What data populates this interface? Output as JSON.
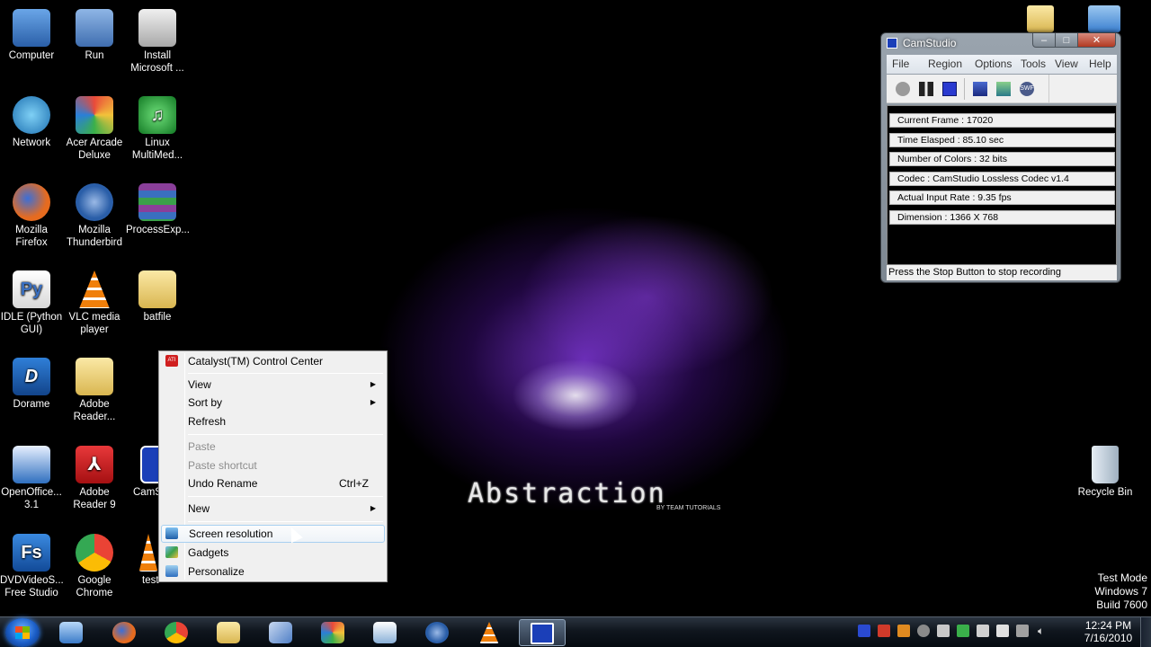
{
  "desktop": {
    "icons": [
      {
        "label": "Computer",
        "icon": "computer-icon",
        "color": "#3d7fcf"
      },
      {
        "label": "Run",
        "icon": "run-icon",
        "color": "#5e8fc9"
      },
      {
        "label": "Install Microsoft ...",
        "icon": "installer-icon",
        "color": "#c9c9c9"
      },
      {
        "label": "Network",
        "icon": "network-icon",
        "color": "#3aa0d8"
      },
      {
        "label": "Acer Arcade Deluxe",
        "icon": "acer-arcade-icon",
        "color": "#e9b84a"
      },
      {
        "label": "Linux MultiMed...",
        "icon": "music-note-icon",
        "color": "#22a33c"
      },
      {
        "label": "Mozilla Firefox",
        "icon": "firefox-icon",
        "color": "#e66b1f"
      },
      {
        "label": "Mozilla Thunderbird",
        "icon": "thunderbird-icon",
        "color": "#2a5ea8"
      },
      {
        "label": "ProcessExp...",
        "icon": "archive-icon",
        "color": "#8a3f9a"
      },
      {
        "label": "IDLE (Python GUI)",
        "icon": "python-file-icon",
        "color": "#e0d98a"
      },
      {
        "label": "VLC media player",
        "icon": "vlc-cone-icon",
        "color": "#f07f0a"
      },
      {
        "label": "batfile",
        "icon": "folder-icon",
        "color": "#e9d27a"
      },
      {
        "label": "Dorame",
        "icon": "dorame-icon",
        "color": "#1f5fa8"
      },
      {
        "label": "Adobe Reader...",
        "icon": "folder-icon",
        "color": "#e9d27a"
      },
      {
        "label": "OpenOffice... 3.1",
        "icon": "openoffice-icon",
        "color": "#2f6fbf"
      },
      {
        "label": "Adobe Reader 9",
        "icon": "adobe-reader-icon",
        "color": "#c8191b"
      },
      {
        "label": "CamS",
        "icon": "camstudio-icon",
        "color": "#1b3fb8"
      },
      {
        "label": "DVDVideoS... Free Studio",
        "icon": "dvdvideosoft-icon",
        "color": "#2062b8"
      },
      {
        "label": "Google Chrome",
        "icon": "chrome-icon",
        "color": "#34a853"
      },
      {
        "label": "test",
        "icon": "vlc-cone-icon",
        "color": "#f07f0a"
      },
      {
        "label": "Recycle Bin",
        "icon": "recycle-bin-icon",
        "color": "#cfd8e0"
      }
    ]
  },
  "wallpaper": {
    "title": "Abstraction",
    "subtitle": "BY TEAM TUTORIALS"
  },
  "context_menu": {
    "items": [
      {
        "label": "Catalyst(TM) Control Center",
        "icon": "ati-icon"
      },
      {
        "label": "View",
        "submenu": true
      },
      {
        "label": "Sort by",
        "submenu": true
      },
      {
        "label": "Refresh"
      },
      {
        "label": "Paste",
        "disabled": true
      },
      {
        "label": "Paste shortcut",
        "disabled": true
      },
      {
        "label": "Undo Rename",
        "shortcut": "Ctrl+Z"
      },
      {
        "label": "New",
        "submenu": true
      },
      {
        "label": "Screen resolution",
        "icon": "display-icon",
        "highlighted": true
      },
      {
        "label": "Gadgets",
        "icon": "gadgets-icon"
      },
      {
        "label": "Personalize",
        "icon": "personalize-icon"
      }
    ],
    "submenu_arrow": "▶"
  },
  "camstudio": {
    "title": "CamStudio",
    "window_buttons": {
      "minimize": "–",
      "maximize": "□",
      "close": "✕"
    },
    "menu": [
      "File",
      "Region",
      "Options",
      "Tools",
      "View",
      "Help"
    ],
    "toolbar": [
      "record-icon",
      "pause-icon",
      "stop-icon",
      "region-icon",
      "annotate-icon",
      "swf-icon"
    ],
    "stats": [
      "Current Frame : 17020",
      "Time Elasped  : 85.10 sec",
      "Number of Colors  : 32 bits",
      "Codec  : CamStudio Lossless Codec v1.4",
      "Actual Input Rate  : 9.35 fps",
      "Dimension  : 1366 X 768"
    ],
    "status": "Press the Stop Button to stop recording"
  },
  "watermark": {
    "line1": "Test Mode",
    "line2": "Windows 7",
    "line3": "Build 7600"
  },
  "taskbar": {
    "pinned": [
      {
        "icon": "explorer-icon",
        "color": "#5a9ad8"
      },
      {
        "icon": "firefox-icon",
        "color": "#e66b1f"
      },
      {
        "icon": "chrome-icon",
        "color": "#34a853"
      },
      {
        "icon": "folder-icon",
        "color": "#e9c65a"
      },
      {
        "icon": "pen-icon",
        "color": "#4f7fc6"
      },
      {
        "icon": "acer-arcade-icon",
        "color": "#e9b84a"
      },
      {
        "icon": "python-file-icon",
        "color": "#8ab0d8"
      },
      {
        "icon": "thunderbird-icon",
        "color": "#2a5ea8"
      },
      {
        "icon": "vlc-cone-icon",
        "color": "#f07f0a"
      },
      {
        "icon": "camstudio-icon",
        "color": "#1b3fb8",
        "active": true
      }
    ],
    "clock_time": "12:24 PM",
    "clock_date": "7/16/2010"
  }
}
